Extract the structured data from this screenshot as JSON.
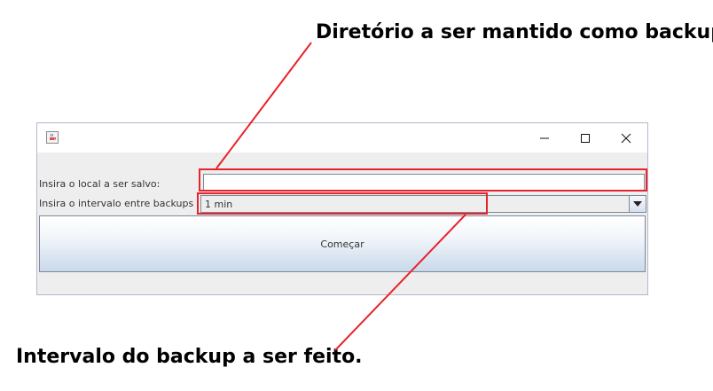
{
  "annotations": {
    "top": "Diretório a ser mantido como backup.",
    "bottom": "Intervalo do backup a ser feito."
  },
  "window": {
    "app_icon": "java-cup-icon",
    "controls": [
      "minimize-icon",
      "maximize-icon",
      "close-icon"
    ]
  },
  "form": {
    "local_label": "Insira o local a ser salvo:",
    "local_value": "",
    "interval_label": "Insira o intervalo entre backups",
    "interval_value": "1 min",
    "start_button": "Começar"
  },
  "colors": {
    "highlight": "#e8222a",
    "button_gradient_bottom": "#c9d9ea",
    "window_bg": "#eeeeee"
  }
}
